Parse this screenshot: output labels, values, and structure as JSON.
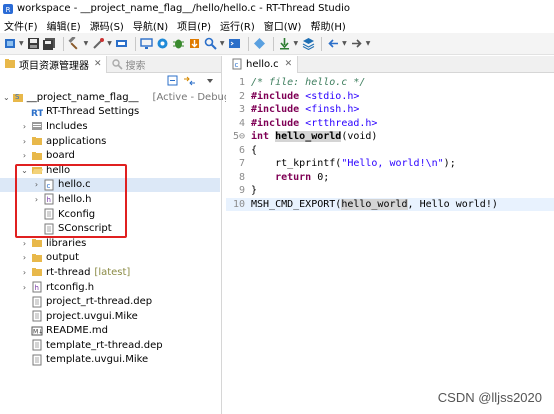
{
  "window": {
    "title": "workspace - __project_name_flag__/hello/hello.c - RT-Thread Studio"
  },
  "menu": [
    "文件(F)",
    "编辑(E)",
    "源码(S)",
    "导航(N)",
    "项目(P)",
    "运行(R)",
    "窗口(W)",
    "帮助(H)"
  ],
  "left_panel": {
    "tab_active": "项目资源管理器",
    "tab_inactive": "搜索"
  },
  "tree": {
    "project": {
      "name": "__project_name_flag__",
      "status": "[Active - Debug]"
    },
    "items": [
      {
        "label": "RT-Thread Settings"
      },
      {
        "label": "Includes"
      },
      {
        "label": "applications"
      },
      {
        "label": "board"
      },
      {
        "label": "hello"
      },
      {
        "label": "hello.c"
      },
      {
        "label": "hello.h"
      },
      {
        "label": "Kconfig"
      },
      {
        "label": "SConscript"
      },
      {
        "label": "libraries"
      },
      {
        "label": "output"
      },
      {
        "label": "rt-thread",
        "suffix": "[latest]"
      },
      {
        "label": "rtconfig.h"
      },
      {
        "label": "project_rt-thread.dep"
      },
      {
        "label": "project.uvgui.Mike"
      },
      {
        "label": "README.md"
      },
      {
        "label": "template_rt-thread.dep"
      },
      {
        "label": "template.uvgui.Mike"
      }
    ]
  },
  "editor": {
    "tab": "hello.c",
    "lines": [
      {
        "n": "1",
        "comment": "/* file: hello.c */"
      },
      {
        "n": "2",
        "kw": "#include",
        "str": " <stdio.h>"
      },
      {
        "n": "3",
        "kw": "#include",
        "str": " <finsh.h>"
      },
      {
        "n": "4",
        "kw": "#include",
        "str": " <rtthread.h>"
      },
      {
        "n": "5⊖",
        "kw": "int",
        "fn": "hello_world",
        "rest": "(void)"
      },
      {
        "n": "6",
        "text": "{"
      },
      {
        "n": "7",
        "pre": "    rt_kprintf(",
        "str": "\"Hello, world!\\n\"",
        "post": ");"
      },
      {
        "n": "8",
        "kw": "    return",
        "rest": " 0;"
      },
      {
        "n": "9",
        "text": "}"
      },
      {
        "n": "10",
        "pre": "MSH_CMD_EXPORT(",
        "fn": "hello_world",
        "post": ", Hello world!)"
      }
    ]
  },
  "watermark": "CSDN @lljss2020",
  "colors": {
    "highlight_box": "#e02020",
    "keyword": "#7f0055",
    "string": "#2a00ff",
    "comment": "#3f7f5f"
  }
}
